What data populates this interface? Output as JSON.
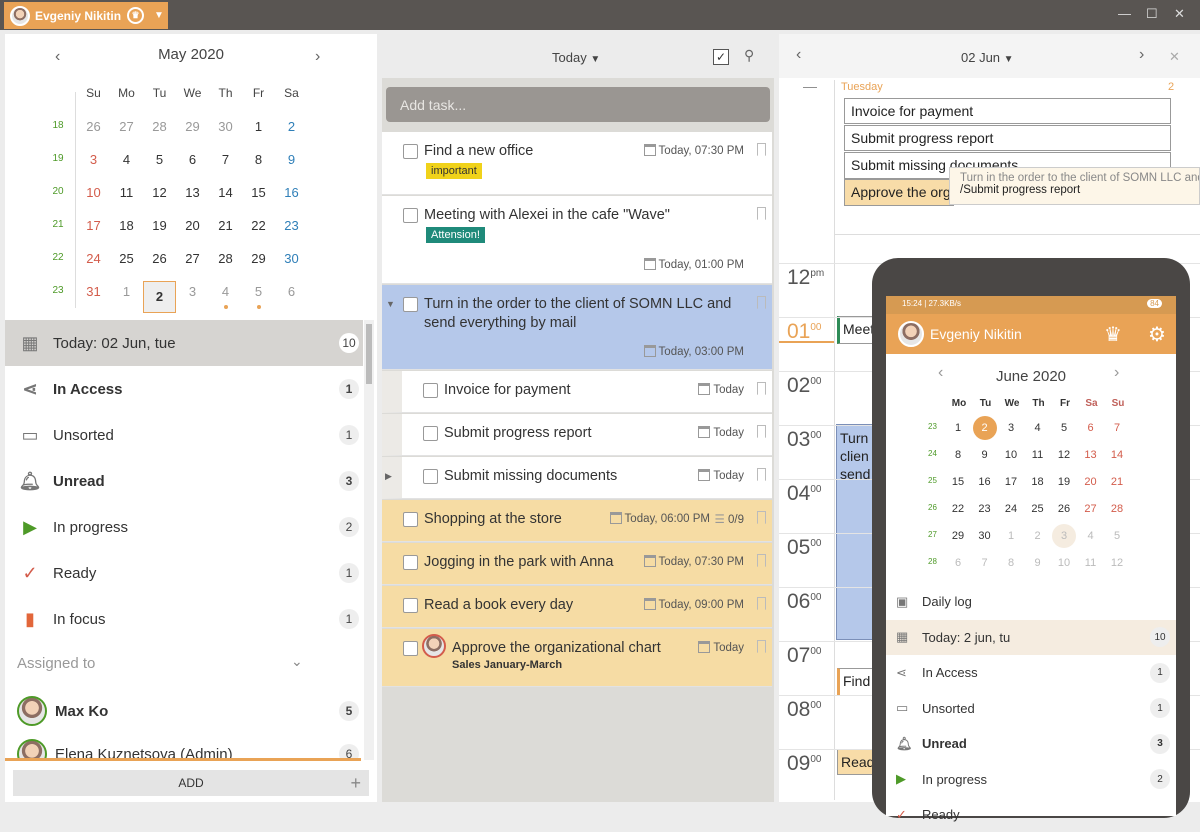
{
  "app": {
    "user": "Evgeniy Nikitin"
  },
  "calendar": {
    "title": "May 2020",
    "days": [
      "Su",
      "Mo",
      "Tu",
      "We",
      "Th",
      "Fr",
      "Sa"
    ],
    "weeks": [
      {
        "wk": "18",
        "d": [
          "26",
          "27",
          "28",
          "29",
          "30",
          "1",
          "2"
        ]
      },
      {
        "wk": "19",
        "d": [
          "3",
          "4",
          "5",
          "6",
          "7",
          "8",
          "9"
        ]
      },
      {
        "wk": "20",
        "d": [
          "10",
          "11",
          "12",
          "13",
          "14",
          "15",
          "16"
        ]
      },
      {
        "wk": "21",
        "d": [
          "17",
          "18",
          "19",
          "20",
          "21",
          "22",
          "23"
        ]
      },
      {
        "wk": "22",
        "d": [
          "24",
          "25",
          "26",
          "27",
          "28",
          "29",
          "30"
        ]
      },
      {
        "wk": "23",
        "d": [
          "31",
          "1",
          "2",
          "3",
          "4",
          "5",
          "6"
        ]
      }
    ]
  },
  "sidebar": {
    "items": [
      {
        "label": "Today: 02 Jun, tue",
        "count": "10",
        "icon": "calendar-icon"
      },
      {
        "label": "In Access",
        "count": "1",
        "icon": "share-icon"
      },
      {
        "label": "Unsorted",
        "count": "1",
        "icon": "inbox-icon"
      },
      {
        "label": "Unread",
        "count": "3",
        "icon": "bell-icon"
      },
      {
        "label": "In progress",
        "count": "2",
        "icon": "play-icon"
      },
      {
        "label": "Ready",
        "count": "1",
        "icon": "check-icon"
      },
      {
        "label": "In focus",
        "count": "1",
        "icon": "bookmark-icon"
      }
    ],
    "assigned_label": "Assigned to",
    "assignees": [
      {
        "name": "Max Ko",
        "count": "5"
      },
      {
        "name": "Elena Kuznetsova (Admin)",
        "count": "6"
      }
    ],
    "add_label": "ADD",
    "add_plus": "+"
  },
  "tasks": {
    "filter": "Today",
    "placeholder": "Add task...",
    "items": [
      {
        "title": "Find a new office",
        "date": "Today, 07:30 PM",
        "tag": "important"
      },
      {
        "title": "Meeting with Alexei in the cafe \"Wave\"",
        "date": "Today, 01:00 PM",
        "tag": "Attension!"
      },
      {
        "title": "Turn in the order to the client of SOMN LLC and send everything by mail",
        "date": "Today, 03:00 PM"
      },
      {
        "title": "Invoice for payment",
        "date": "Today"
      },
      {
        "title": "Submit progress report",
        "date": "Today"
      },
      {
        "title": "Submit missing documents",
        "date": "Today"
      },
      {
        "title": "Shopping at the store",
        "date": "Today, 06:00 PM",
        "sub": "0/9"
      },
      {
        "title": "Jogging in the park with Anna",
        "date": "Today, 07:30 PM"
      },
      {
        "title": "Read a book every day",
        "date": "Today, 09:00 PM"
      },
      {
        "title": "Approve the organizational chart",
        "date": "Today",
        "subtitle": "Sales January-March"
      }
    ]
  },
  "day": {
    "date": "02 Jun",
    "weekday": "Tuesday",
    "alldaycount": "2",
    "events": [
      "Invoice for payment",
      "Submit progress report",
      "Submit missing documents",
      "Approve the org"
    ],
    "tooltip1": "Turn in the order to the client of SOMN LLC and",
    "tooltip2": "/Submit progress report",
    "hours": [
      {
        "h": "12",
        "s": "pm"
      },
      {
        "h": "01",
        "s": "00"
      },
      {
        "h": "02",
        "s": "00"
      },
      {
        "h": "03",
        "s": "00"
      },
      {
        "h": "04",
        "s": "00"
      },
      {
        "h": "05",
        "s": "00"
      },
      {
        "h": "06",
        "s": "00"
      },
      {
        "h": "07",
        "s": "00"
      },
      {
        "h": "08",
        "s": "00"
      },
      {
        "h": "09",
        "s": "00"
      }
    ],
    "ev_meet": "Meet",
    "ev_turn": [
      "Turn",
      "clien",
      "send"
    ],
    "ev_find": "Find",
    "ev_read": "Read"
  },
  "phone": {
    "status": "15:24 | 27.3KB/s",
    "battery": "84",
    "user": "Evgeniy Nikitin",
    "cal_title": "June 2020",
    "days": [
      "Mo",
      "Tu",
      "We",
      "Th",
      "Fr",
      "Sa",
      "Su"
    ],
    "weeks": [
      {
        "wk": "23",
        "d": [
          "1",
          "2",
          "3",
          "4",
          "5",
          "6",
          "7"
        ]
      },
      {
        "wk": "24",
        "d": [
          "8",
          "9",
          "10",
          "11",
          "12",
          "13",
          "14"
        ]
      },
      {
        "wk": "25",
        "d": [
          "15",
          "16",
          "17",
          "18",
          "19",
          "20",
          "21"
        ]
      },
      {
        "wk": "26",
        "d": [
          "22",
          "23",
          "24",
          "25",
          "26",
          "27",
          "28"
        ]
      },
      {
        "wk": "27",
        "d": [
          "29",
          "30",
          "1",
          "2",
          "3",
          "4",
          "5"
        ]
      },
      {
        "wk": "28",
        "d": [
          "6",
          "7",
          "8",
          "9",
          "10",
          "11",
          "12"
        ]
      }
    ],
    "items": [
      {
        "label": "Daily log",
        "count": ""
      },
      {
        "label": "Today: 2 jun, tu",
        "count": "10"
      },
      {
        "label": "In Access",
        "count": "1"
      },
      {
        "label": "Unsorted",
        "count": "1"
      },
      {
        "label": "Unread",
        "count": "3"
      },
      {
        "label": "In progress",
        "count": "2"
      },
      {
        "label": "Ready",
        "count": ""
      }
    ]
  }
}
